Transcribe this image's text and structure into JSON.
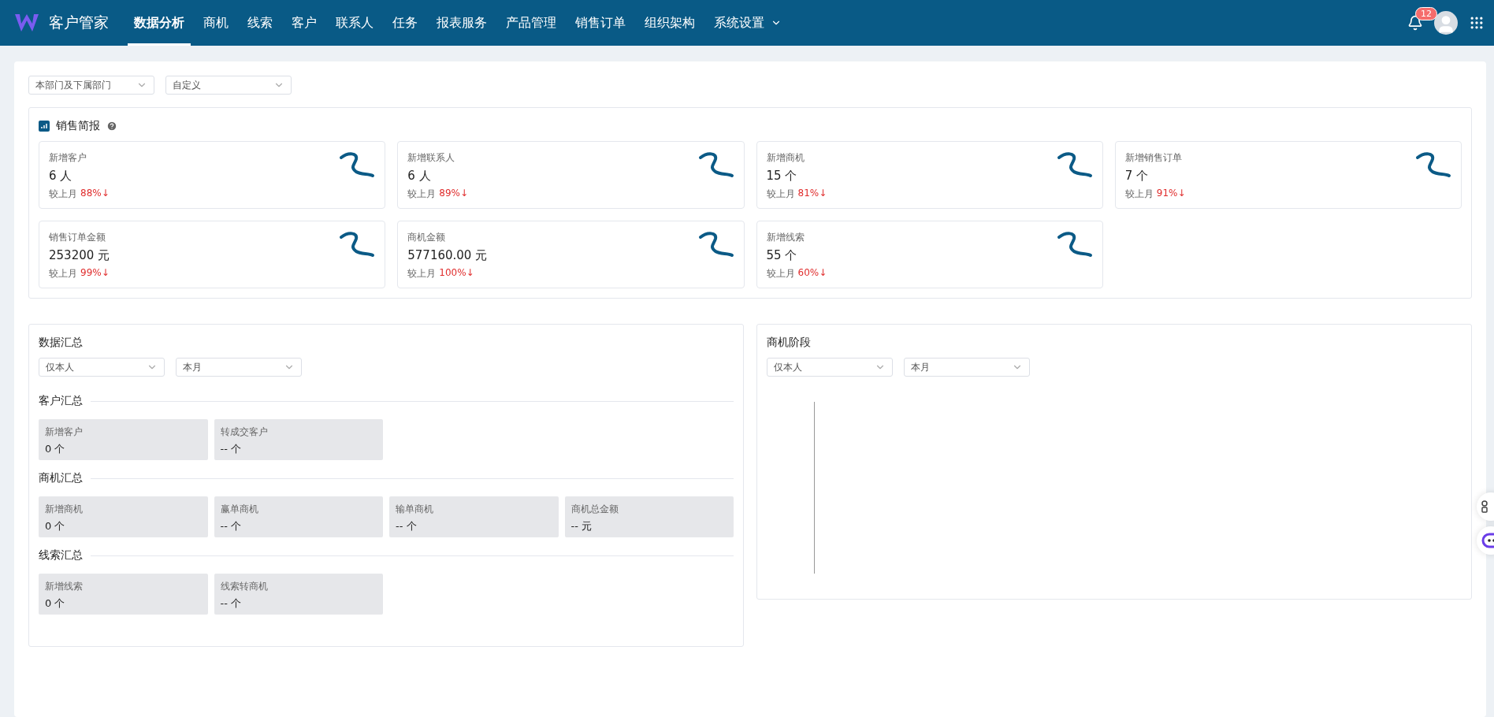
{
  "header": {
    "brand": "客户管家",
    "nav": [
      {
        "label": "数据分析",
        "selected": true
      },
      {
        "label": "商机",
        "selected": false
      },
      {
        "label": "线索",
        "selected": false
      },
      {
        "label": "客户",
        "selected": false
      },
      {
        "label": "联系人",
        "selected": false
      },
      {
        "label": "任务",
        "selected": false
      },
      {
        "label": "报表服务",
        "selected": false
      },
      {
        "label": "产品管理",
        "selected": false
      },
      {
        "label": "销售订单",
        "selected": false
      },
      {
        "label": "组织架构",
        "selected": false
      },
      {
        "label": "系统设置",
        "selected": false,
        "dropdown": true
      }
    ],
    "notification_count": "12"
  },
  "filters": [
    {
      "value": "本部门及下属部门"
    },
    {
      "value": "自定义"
    }
  ],
  "sales_brief": {
    "title": "销售简报",
    "cards": [
      {
        "label": "新增客户",
        "value": "6 人",
        "compare": "较上月",
        "change": "88%↓"
      },
      {
        "label": "新增联系人",
        "value": "6 人",
        "compare": "较上月",
        "change": "89%↓"
      },
      {
        "label": "新增商机",
        "value": "15 个",
        "compare": "较上月",
        "change": "81%↓"
      },
      {
        "label": "新增销售订单",
        "value": "7 个",
        "compare": "较上月",
        "change": "91%↓"
      },
      {
        "label": "销售订单金额",
        "value": "253200 元",
        "compare": "较上月",
        "change": "99%↓"
      },
      {
        "label": "商机金额",
        "value": "577160.00 元",
        "compare": "较上月",
        "change": "100%↓"
      },
      {
        "label": "新增线索",
        "value": "55 个",
        "compare": "较上月",
        "change": "60%↓"
      }
    ]
  },
  "data_summary": {
    "title": "数据汇总",
    "filters": [
      {
        "value": "仅本人"
      },
      {
        "value": "本月"
      }
    ],
    "groups": [
      {
        "title": "客户汇总",
        "items": [
          {
            "label": "新增客户",
            "value": "0 个"
          },
          {
            "label": "转成交客户",
            "value": "-- 个"
          }
        ]
      },
      {
        "title": "商机汇总",
        "items": [
          {
            "label": "新增商机",
            "value": "0 个"
          },
          {
            "label": "赢单商机",
            "value": "-- 个"
          },
          {
            "label": "输单商机",
            "value": "-- 个"
          },
          {
            "label": "商机总金额",
            "value": "-- 元"
          }
        ]
      },
      {
        "title": "线索汇总",
        "items": [
          {
            "label": "新增线索",
            "value": "0 个"
          },
          {
            "label": "线索转商机",
            "value": "-- 个"
          }
        ]
      }
    ]
  },
  "opportunity_stage": {
    "title": "商机阶段",
    "filters": [
      {
        "value": "仅本人"
      },
      {
        "value": "本月"
      }
    ]
  }
}
